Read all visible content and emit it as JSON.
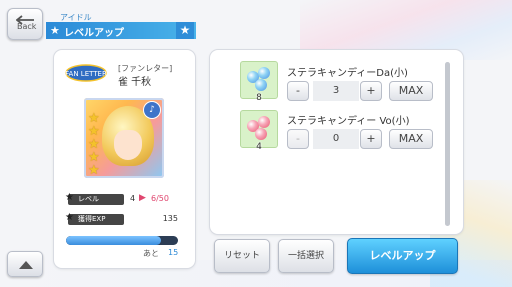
{
  "header": {
    "back_label": "Back",
    "subtitle": "アイドル",
    "title": "レベルアップ"
  },
  "card": {
    "kind": "[ファンレター]",
    "name": "雀 千秋",
    "rarity_stars": 5,
    "fan_logo_text": "FAN LETTER"
  },
  "stats": {
    "level_label": "レベル",
    "level_current": "4",
    "level_new": "6/50",
    "exp_label": "獲得EXP",
    "exp_value": "135",
    "exp_progress": 0.85,
    "remain_label": "あと",
    "remain_value": "15"
  },
  "items": [
    {
      "name": "ステラキャンディーDa(小)",
      "count": "8",
      "qty": "3",
      "minus": "-",
      "plus": "+",
      "max": "MAX",
      "minus_enabled": true,
      "color_main": "#4a90e2",
      "color_sub": "#8fd3f4"
    },
    {
      "name": "ステラキャンディー Vo(小)",
      "count": "4",
      "qty": "0",
      "minus": "-",
      "plus": "+",
      "max": "MAX",
      "minus_enabled": false,
      "color_main": "#e8566f",
      "color_sub": "#f7a6b8"
    }
  ],
  "buttons": {
    "reset": "リセット",
    "select_all": "一括選択",
    "level_up": "レベルアップ"
  },
  "colors": {
    "accent": "#2b8ad7",
    "levelup_gradient_top": "#5fd1ff",
    "level_new": "#e0466f"
  }
}
